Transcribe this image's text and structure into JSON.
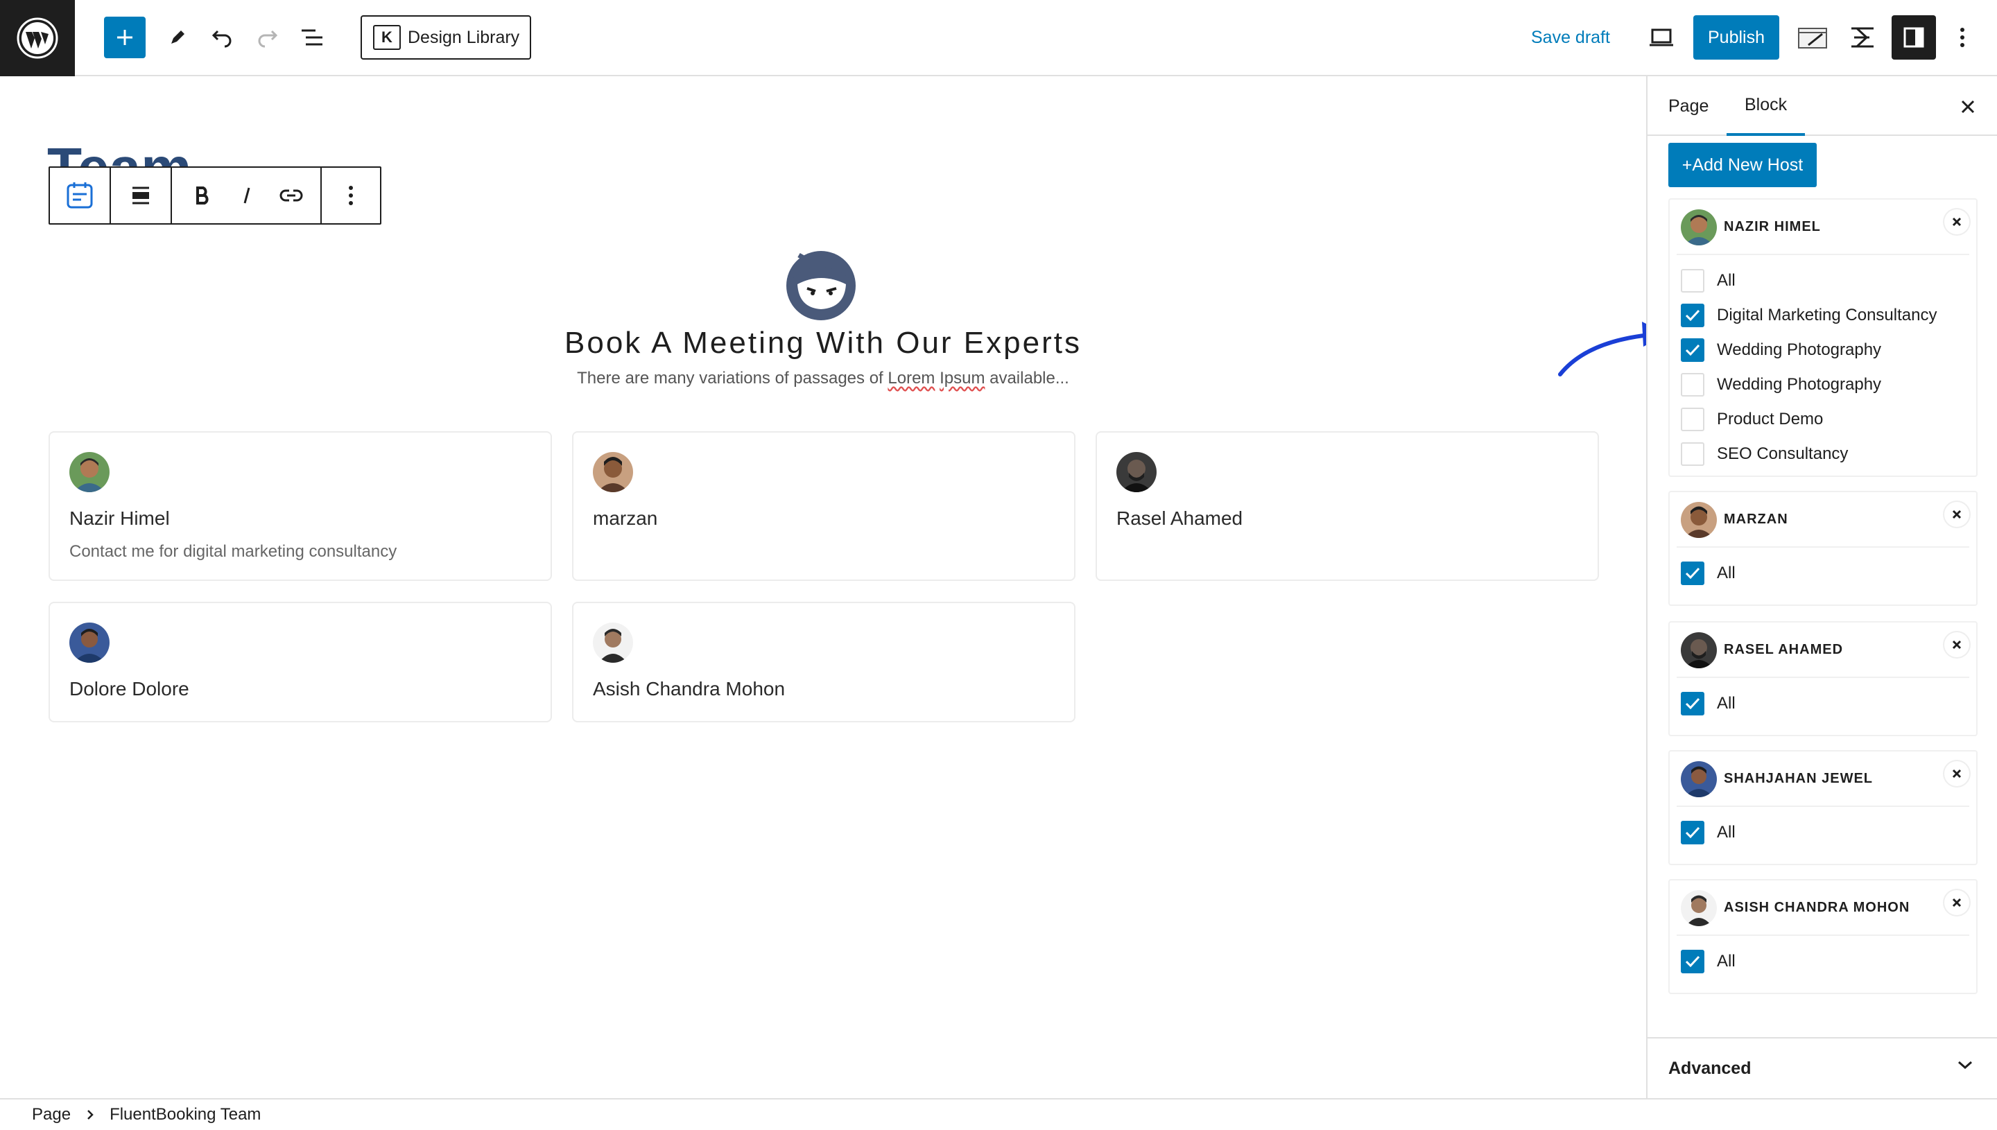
{
  "toolbar": {
    "design_library_label": "Design Library",
    "save_draft_label": "Save draft",
    "publish_label": "Publish"
  },
  "canvas": {
    "page_title": "Team",
    "headline": "Book A Meeting With Our Experts",
    "subline_before": "There are many variations of passages of ",
    "subline_lorem": "Lorem",
    "subline_space": " ",
    "subline_ipsum": "Ipsum",
    "subline_after": " available...",
    "cards": [
      {
        "name": "Nazir Himel",
        "desc": "Contact me for digital marketing consultancy"
      },
      {
        "name": "marzan",
        "desc": ""
      },
      {
        "name": "Rasel Ahamed",
        "desc": ""
      },
      {
        "name": "Dolore Dolore",
        "desc": ""
      },
      {
        "name": "Asish Chandra Mohon",
        "desc": ""
      }
    ]
  },
  "sidebar": {
    "tabs": [
      "Page",
      "Block"
    ],
    "active_tab": "Block",
    "add_host_label": "+Add New Host",
    "hosts": [
      {
        "name": "NAZIR HIMEL",
        "services": [
          {
            "label": "All",
            "checked": false
          },
          {
            "label": "Digital Marketing Consultancy",
            "checked": true
          },
          {
            "label": "Wedding Photography",
            "checked": true
          },
          {
            "label": "Wedding Photography",
            "checked": false
          },
          {
            "label": "Product Demo",
            "checked": false
          },
          {
            "label": "SEO Consultancy",
            "checked": false
          }
        ]
      },
      {
        "name": "MARZAN",
        "services": [
          {
            "label": "All",
            "checked": true
          }
        ]
      },
      {
        "name": "RASEL AHAMED",
        "services": [
          {
            "label": "All",
            "checked": true
          }
        ]
      },
      {
        "name": "SHAHJAHAN JEWEL",
        "services": [
          {
            "label": "All",
            "checked": true
          }
        ]
      },
      {
        "name": "ASISH CHANDRA MOHON",
        "services": [
          {
            "label": "All",
            "checked": true
          }
        ]
      }
    ],
    "advanced_label": "Advanced"
  },
  "breadcrumb": {
    "root": "Page",
    "current": "FluentBooking Team"
  },
  "colors": {
    "accent": "#007cba",
    "title_blue": "#2b4a77",
    "dark": "#1e1e1e",
    "arrow": "#1a3fd6"
  }
}
